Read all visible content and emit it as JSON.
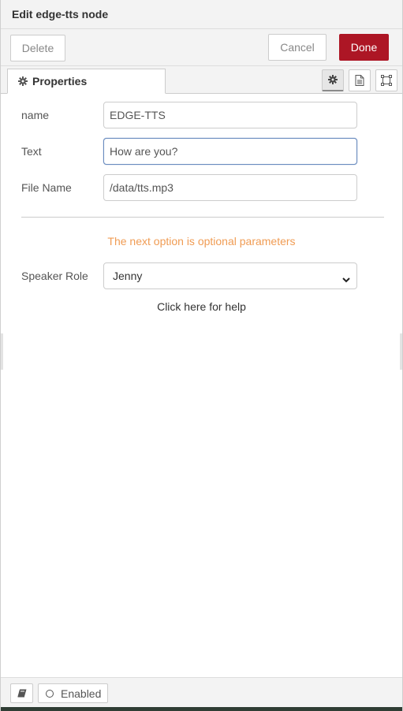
{
  "header": {
    "title": "Edit edge-tts node"
  },
  "toolbar": {
    "delete_label": "Delete",
    "cancel_label": "Cancel",
    "done_label": "Done"
  },
  "tabs": {
    "properties_label": "Properties"
  },
  "icons": {
    "properties": "gear-icon",
    "description": "document-icon",
    "appearance": "frame-icon",
    "book": "book-icon",
    "enabled": "circle-icon",
    "select": "chevron-down-icon"
  },
  "form": {
    "name": {
      "label": "name",
      "value": "EDGE-TTS"
    },
    "text": {
      "label": "Text",
      "value": "How are you?"
    },
    "filename": {
      "label": "File Name",
      "value": "/data/tts.mp3"
    },
    "optional_notice": "The next option is optional parameters",
    "speaker": {
      "label": "Speaker Role",
      "value": "Jenny"
    },
    "help_link": "Click here for help"
  },
  "footer": {
    "enabled_label": "Enabled"
  },
  "colors": {
    "done_button": "#ad1625",
    "notice_text": "#f09c54",
    "focus_border": "#6a8cbf"
  }
}
